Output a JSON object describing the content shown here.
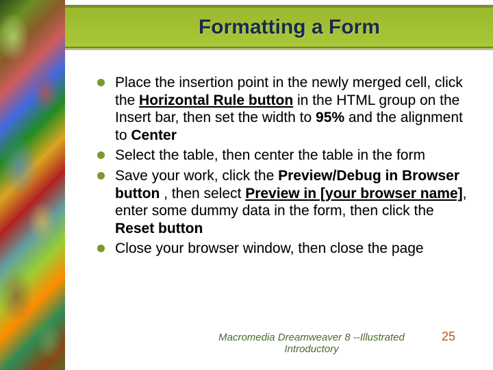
{
  "title": "Formatting a Form",
  "bullets": [
    {
      "segments": [
        {
          "t": "Place the insertion point in the newly merged cell, click the "
        },
        {
          "t": "Horizontal Rule button",
          "bold": true,
          "underline": true
        },
        {
          "t": " in the HTML group on the Insert bar, then set the width to "
        },
        {
          "t": "95%",
          "bold": true
        },
        {
          "t": " and the alignment to "
        },
        {
          "t": "Center",
          "bold": true
        }
      ]
    },
    {
      "segments": [
        {
          "t": "Select the table, then center the table in the form"
        }
      ]
    },
    {
      "segments": [
        {
          "t": "Save your work, click the "
        },
        {
          "t": "Preview/Debug in Browser button",
          "bold": true
        },
        {
          "t": " , then select "
        },
        {
          "t": "Preview in [your browser name]",
          "bold": true,
          "underline": true
        },
        {
          "t": ", enter some dummy data in the form, then click the "
        },
        {
          "t": "Reset button",
          "bold": true
        }
      ]
    },
    {
      "segments": [
        {
          "t": "Close your browser window, then close the page"
        }
      ]
    }
  ],
  "footer_text": "Macromedia Dreamweaver 8 --Illustrated Introductory",
  "page_number": "25"
}
